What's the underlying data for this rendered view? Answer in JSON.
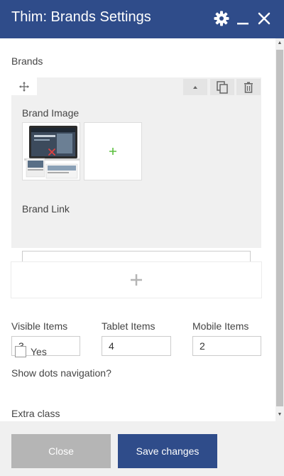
{
  "window": {
    "title": "Thim: Brands Settings"
  },
  "brands_section": {
    "label": "Brands",
    "items": [
      {
        "brand_image_label": "Brand Image",
        "brand_link_label": "Brand Link",
        "brand_link_value": ""
      }
    ]
  },
  "items": {
    "visible_label": "Visible Items",
    "visible_value": "3",
    "tablet_label": "Tablet Items",
    "tablet_value": "4",
    "mobile_label": "Mobile Items",
    "mobile_value": "2"
  },
  "dots": {
    "label": "Show dots navigation?",
    "option_label": "Yes",
    "checked": false
  },
  "extra_class": {
    "label": "Extra class"
  },
  "footer": {
    "close_label": "Close",
    "save_label": "Save changes"
  },
  "colors": {
    "titlebar": "#2f4c8a",
    "save_button": "#2f4c8a",
    "close_button": "#b5b5b5",
    "add_image_plus": "#5bbf3f",
    "delete_x": "#e04040"
  }
}
